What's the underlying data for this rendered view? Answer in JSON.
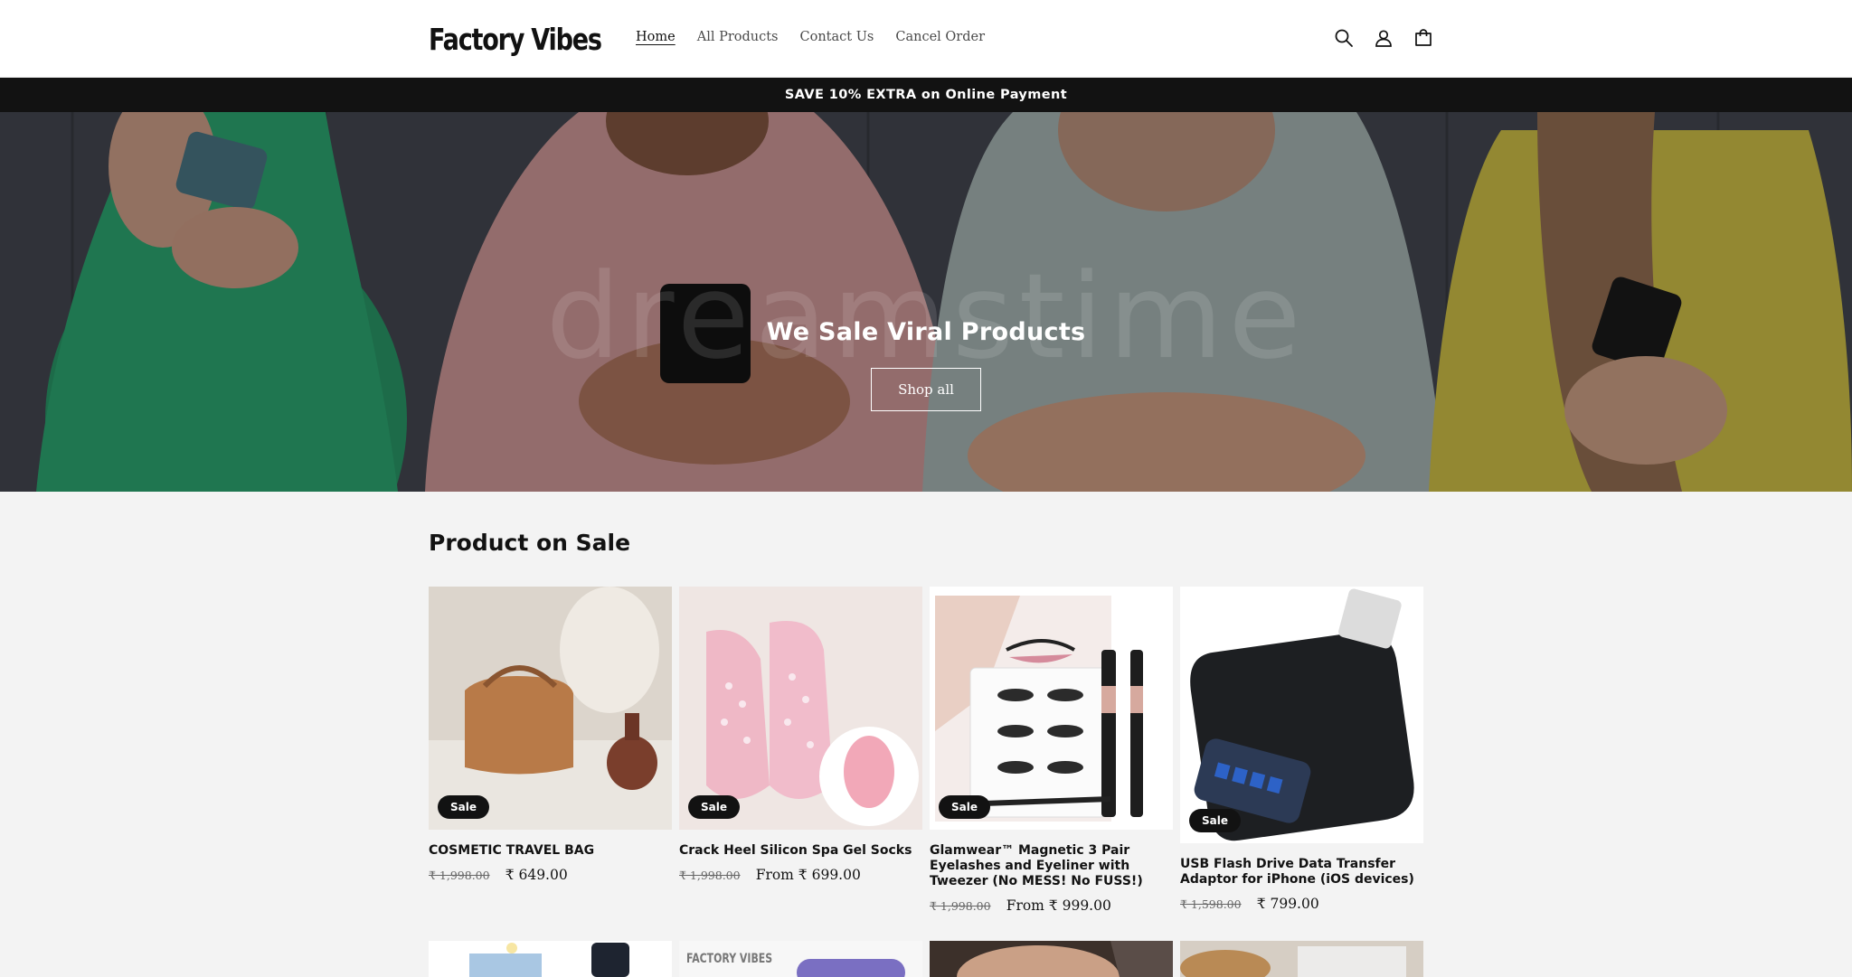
{
  "header": {
    "logo": "Factory Vibes",
    "nav": [
      {
        "label": "Home",
        "active": true
      },
      {
        "label": "All Products",
        "active": false
      },
      {
        "label": "Contact Us",
        "active": false
      },
      {
        "label": "Cancel Order",
        "active": false
      }
    ],
    "icons": [
      "search-icon",
      "account-icon",
      "cart-icon"
    ]
  },
  "announcement": "SAVE 10% EXTRA on Online Payment",
  "hero": {
    "title": "We Sale Viral Products",
    "button": "Shop all",
    "watermark": "dreamstime"
  },
  "section": {
    "title": "Product on Sale",
    "products": [
      {
        "name": "COSMETIC TRAVEL BAG",
        "badge": "Sale",
        "old_price": "₹ 1,998.00",
        "price": "₹ 649.00"
      },
      {
        "name": "Crack Heel Silicon Spa Gel Socks",
        "badge": "Sale",
        "old_price": "₹ 1,998.00",
        "price": "From ₹ 699.00"
      },
      {
        "name": "Glamwear™ Magnetic 3 Pair Eyelashes and Eyeliner with Tweezer (No MESS! No FUSS!)",
        "badge": "Sale",
        "old_price": "₹ 1,998.00",
        "price": "From ₹ 999.00"
      },
      {
        "name": "USB Flash Drive Data Transfer Adaptor for iPhone (iOS devices)",
        "badge": "Sale",
        "old_price": "₹ 1,598.00",
        "price": "₹ 799.00"
      }
    ],
    "row2_logo": "FACTORY VIBES"
  },
  "colors": {
    "header_bg": "#ffffff",
    "announcement_bg": "#121212",
    "page_bg": "#f3f3f3",
    "badge_bg": "#121212"
  }
}
